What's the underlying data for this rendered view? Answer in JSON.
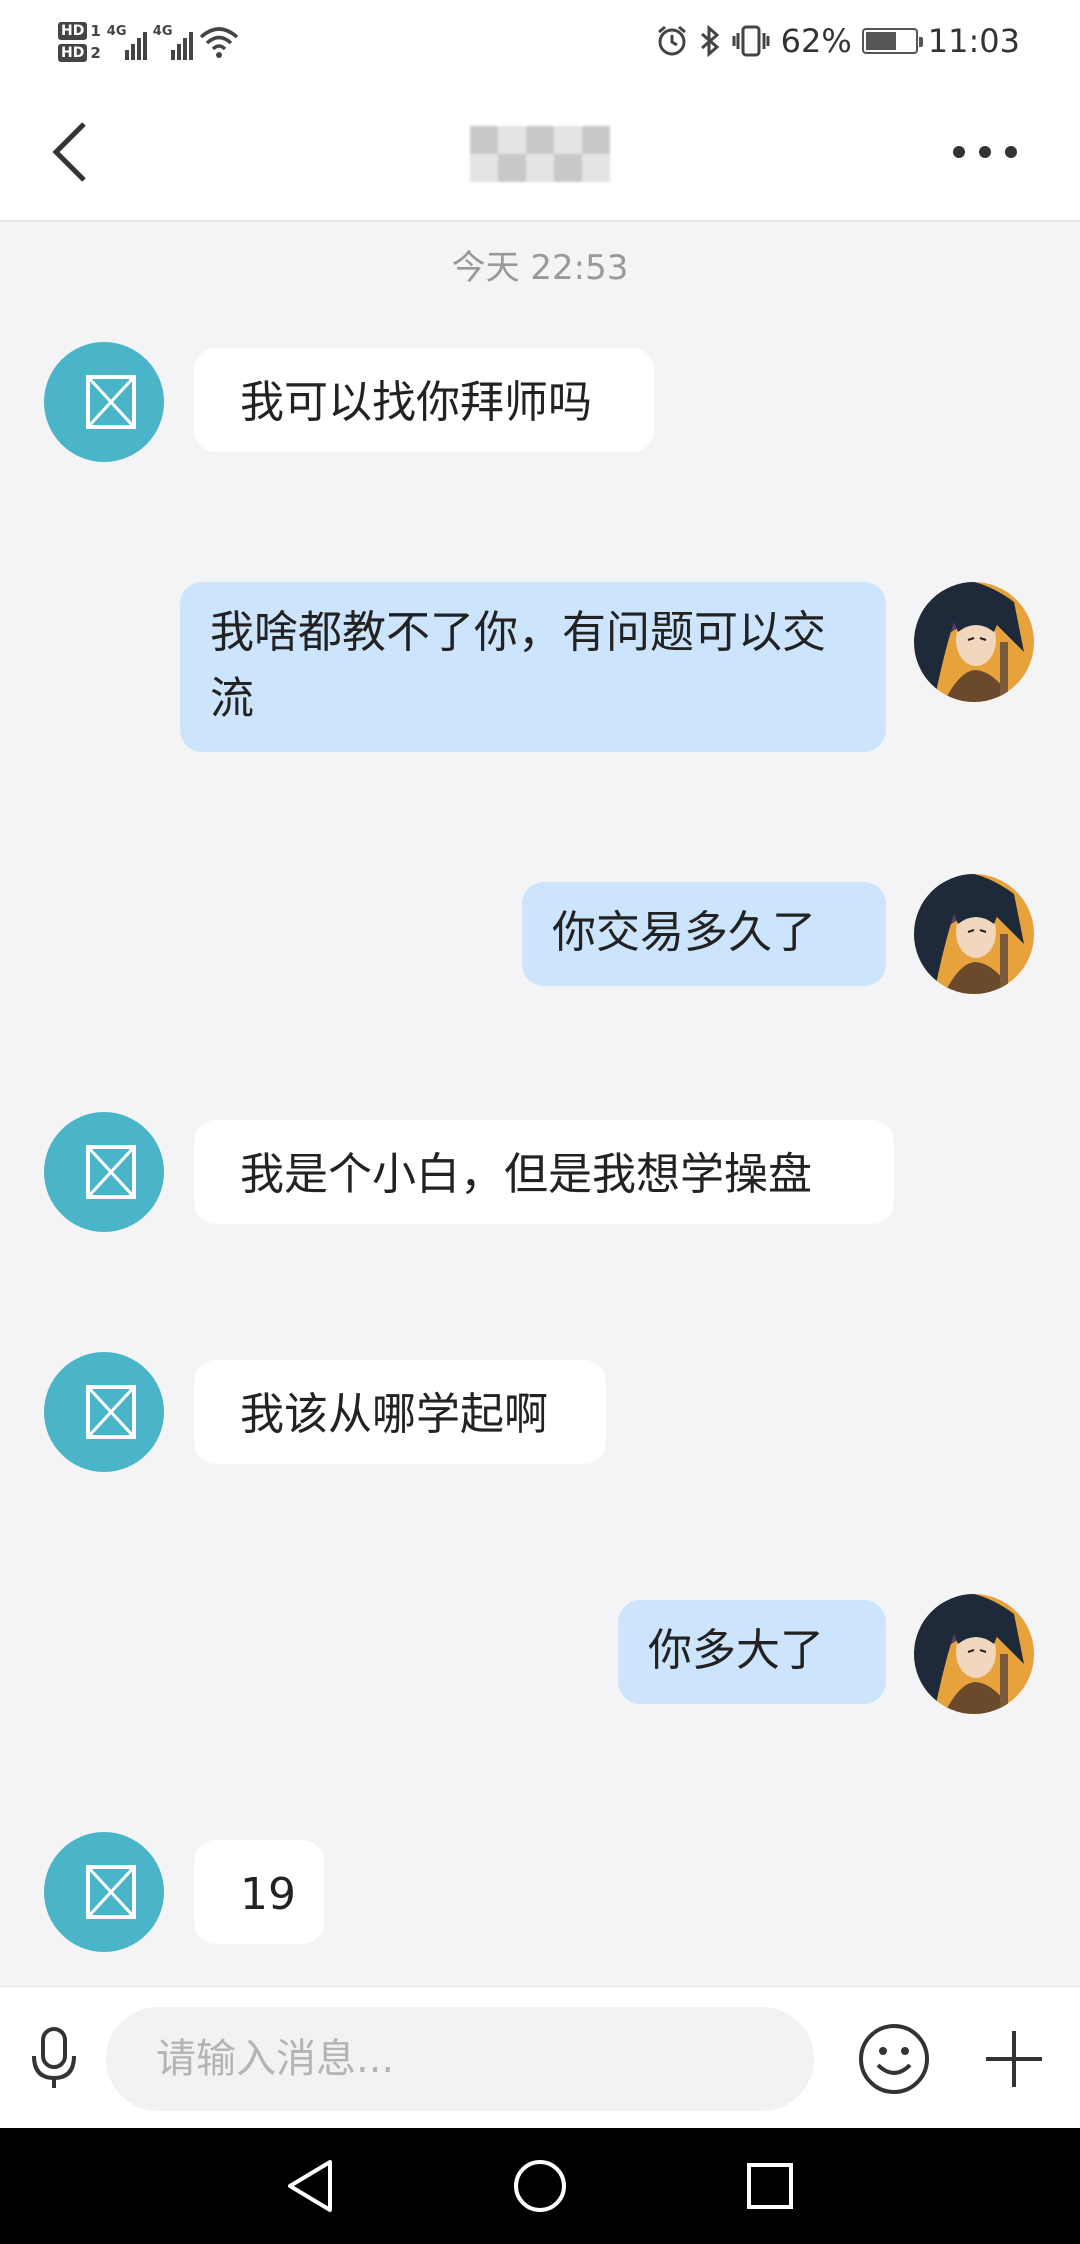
{
  "status_bar": {
    "network_1": "HD",
    "sim_1": "1",
    "network_2": "HD",
    "sim_2": "2",
    "signal_type_1": "4G",
    "signal_type_2": "4G",
    "battery_percent": "62%",
    "time": "11:03",
    "icons": [
      "wifi-icon",
      "alarm-icon",
      "bluetooth-icon",
      "vibrate-icon",
      "battery-icon"
    ]
  },
  "header": {
    "back_icon": "chevron-left-icon",
    "title_obscured": true,
    "more_icon": "more-horizontal-icon"
  },
  "chat": {
    "timestamp": "今天 22:53",
    "messages": [
      {
        "side": "in",
        "text": "我可以找你拜师吗",
        "avatar": "broken-image-avatar"
      },
      {
        "side": "out",
        "text": "我啥都教不了你，有问题可以交流",
        "avatar": "anime-character-avatar"
      },
      {
        "side": "out",
        "text": "你交易多久了",
        "avatar": "anime-character-avatar"
      },
      {
        "side": "in",
        "text": "我是个小白，但是我想学操盘",
        "avatar": "broken-image-avatar"
      },
      {
        "side": "in",
        "text": "我该从哪学起啊",
        "avatar": "broken-image-avatar"
      },
      {
        "side": "out",
        "text": "你多大了",
        "avatar": "anime-character-avatar"
      },
      {
        "side": "in",
        "text": "19",
        "avatar": "broken-image-avatar"
      }
    ]
  },
  "input_bar": {
    "placeholder": "请输入消息...",
    "value": "",
    "mic_icon": "microphone-icon",
    "emoji_icon": "emoji-icon",
    "plus_icon": "plus-icon"
  },
  "nav_bar": {
    "icons": [
      "back-triangle-icon",
      "home-circle-icon",
      "recents-square-icon"
    ]
  },
  "colors": {
    "background": "#f4f4f6",
    "incoming_bubble": "#ffffff",
    "outgoing_bubble": "#cce4fc",
    "avatar_placeholder": "#4ab5c9",
    "nav_bar": "#000000"
  }
}
